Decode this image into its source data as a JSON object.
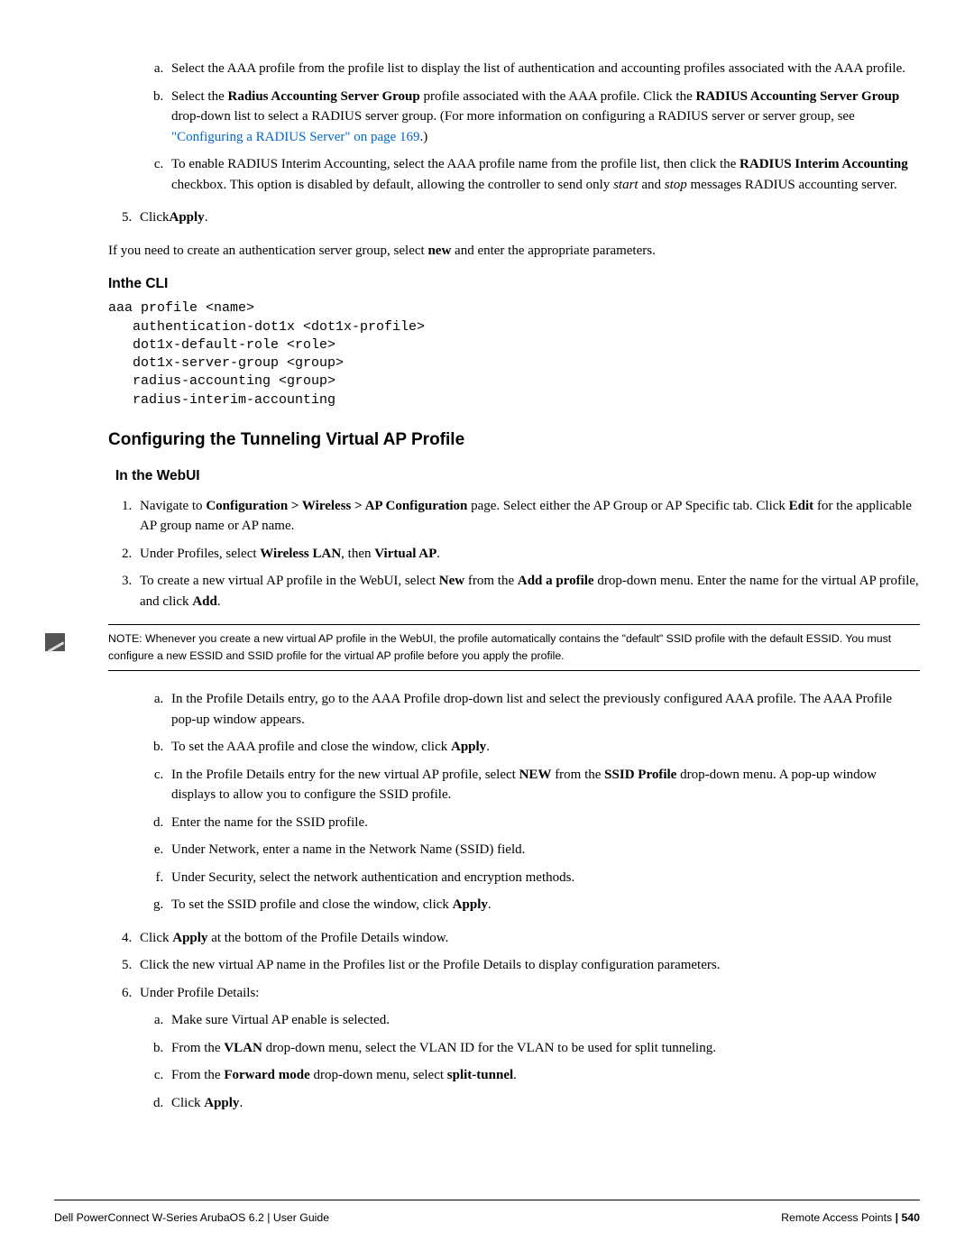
{
  "list1": {
    "a": {
      "t1": "Select the AAA profile from the profile list to display the list of authentication and accounting profiles associated with the AAA profile."
    },
    "b": {
      "t1": "Select the ",
      "b1": "Radius Accounting Server Group",
      "t2": " profile associated with the AAA profile. Click the ",
      "b2": "RADIUS Accounting Server Group",
      "t3": " drop-down list to select a RADIUS server group. (For more information on configuring a RADIUS server or server group, see ",
      "link": "\"Configuring a RADIUS Server\" on page 169",
      "t4": ".)"
    },
    "c": {
      "t1": "To enable RADIUS Interim Accounting, select the AAA profile name from the profile list, then click the ",
      "b1": "RADIUS Interim Accounting",
      "t2": " checkbox. This option is disabled by default, allowing the controller to send only ",
      "i1": "start",
      "t3": " and ",
      "i2": "stop",
      "t4": " messages RADIUS accounting server."
    }
  },
  "step5": {
    "t1": "Click",
    "b1": "Apply",
    "t2": "."
  },
  "para_new": {
    "t1": "If you need to create an authentication server group, select ",
    "b1": "new",
    "t2": " and enter the appropriate parameters."
  },
  "h3_cli": "Inthe CLI",
  "cli_block": "aaa profile <name>\n   authentication-dot1x <dot1x-profile>\n   dot1x-default-role <role>\n   dot1x-server-group <group>\n   radius-accounting <group>\n   radius-interim-accounting",
  "h2_vap": "Configuring the Tunneling Virtual AP Profile",
  "h3_webui": "In the WebUI",
  "webui": {
    "s1": {
      "t1": "Navigate to ",
      "b1": "Configuration > Wireless > AP Configuration",
      "t2": " page. Select either the AP Group or AP Specific tab. Click ",
      "b2": "Edit",
      "t3": " for the applicable AP group name or AP name."
    },
    "s2": {
      "t1": "Under Profiles, select ",
      "b1": "Wireless LAN",
      "t2": ", then ",
      "b2": "Virtual AP",
      "t3": "."
    },
    "s3": {
      "t1": "To create a new virtual AP profile in the WebUI, select ",
      "b1": "New",
      "t2": " from the ",
      "b2": "Add a profile",
      "t3": " drop-down menu. Enter the name for the virtual AP profile, and click ",
      "b3": "Add",
      "t4": "."
    }
  },
  "note": "NOTE: Whenever you create a new virtual AP profile in the WebUI, the profile automatically contains the \"default\" SSID profile with the default ESSID. You must configure a new ESSID and SSID profile for the virtual AP profile before you apply the profile.",
  "sub1": {
    "a": "In the Profile Details entry, go to the AAA Profile drop-down list and select the previously configured AAA profile. The AAA Profile pop-up window appears.",
    "b": {
      "t1": "To set the AAA profile and close the window, click ",
      "b1": "Apply",
      "t2": "."
    },
    "c": {
      "t1": "In the Profile Details entry for the new virtual AP profile, select ",
      "b1": "NEW",
      "t2": " from the ",
      "b2": "SSID Profile",
      "t3": " drop-down menu. A pop-up window displays to allow you to configure the SSID profile."
    },
    "d": "Enter the name for the SSID profile.",
    "e": "Under Network, enter a name in the Network Name (SSID) field.",
    "f": "Under Security, select the network authentication and encryption methods.",
    "g": {
      "t1": "To set the SSID profile and close the window, click ",
      "b1": "Apply",
      "t2": "."
    }
  },
  "s4": {
    "t1": "Click ",
    "b1": "Apply",
    "t2": " at the bottom of the Profile Details window."
  },
  "s5": "Click the new virtual AP name in the Profiles list or the Profile Details to display configuration parameters.",
  "s6": "Under Profile Details:",
  "sub6": {
    "a": "Make sure Virtual AP enable is selected.",
    "b": {
      "t1": "From the ",
      "b1": "VLAN",
      "t2": " drop-down menu, select the VLAN ID for the VLAN to be used for split tunneling."
    },
    "c": {
      "t1": "From the ",
      "b1": "Forward mode",
      "t2": " drop-down menu, select ",
      "b2": "split-tunnel",
      "t3": "."
    },
    "d": {
      "t1": "Click ",
      "b1": "Apply",
      "t2": "."
    }
  },
  "footer": {
    "left": "Dell PowerConnect W-Series ArubaOS 6.2",
    "left_sep": "    |   ",
    "left2": "User Guide",
    "right1": "Remote Access Points ",
    "right_sep": " | ",
    "right2": " 540"
  }
}
